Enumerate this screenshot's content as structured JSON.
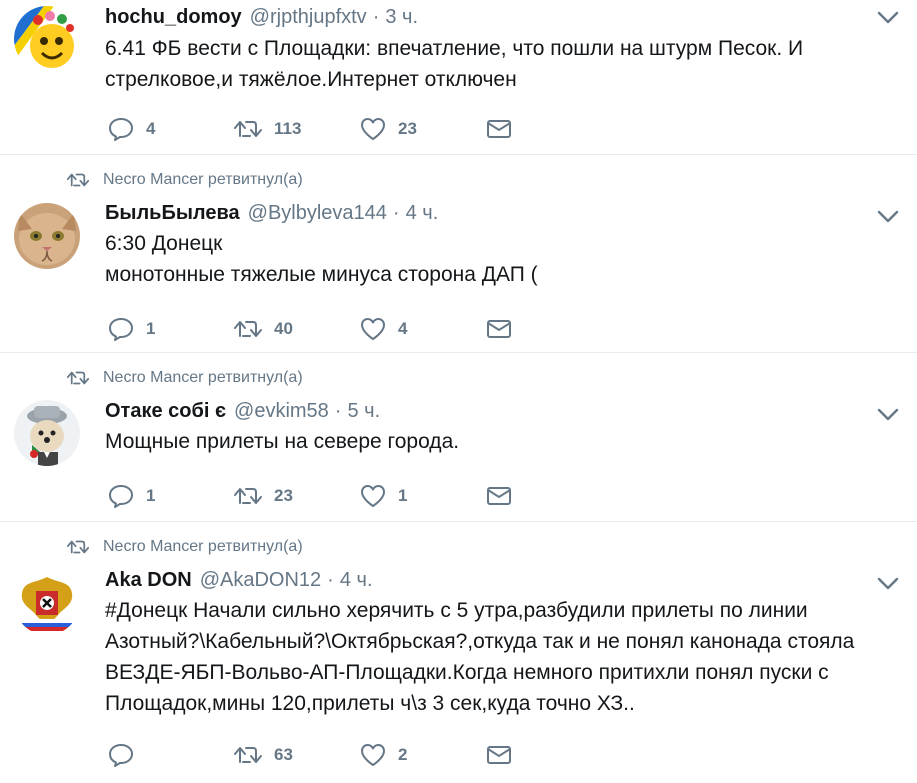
{
  "tweets": [
    {
      "retweeted_by": "",
      "fullname": "hochu_domoy",
      "username": "@rjpthjupfxtv",
      "dot": "·",
      "time": "3 ч.",
      "text": "6.41 ФБ вести с Площадки: впечатление, что пошли на штурм Песок. И\nстрелковое,и тяжёлое.Интернет отключен",
      "replies": "4",
      "retweets": "113",
      "likes": "23"
    },
    {
      "retweeted_by": "Necro Mancer ретвитнул(а)",
      "fullname": "БыльБылева",
      "username": "@Bylbyleva144",
      "dot": "·",
      "time": "4 ч.",
      "text": "6:30 Донецк\nмонотонные тяжелые минуса сторона ДАП (",
      "replies": "1",
      "retweets": "40",
      "likes": "4"
    },
    {
      "retweeted_by": "Necro Mancer ретвитнул(а)",
      "fullname": "Отаке собі є",
      "username": "@evkim58",
      "dot": "·",
      "time": "5 ч.",
      "text": "Мощные прилеты на севере города.",
      "replies": "1",
      "retweets": "23",
      "likes": "1"
    },
    {
      "retweeted_by": "Necro Mancer ретвитнул(а)",
      "fullname": "Aka DON",
      "username": "@AkaDON12",
      "dot": "·",
      "time": "4 ч.",
      "text": "#Донецк Начали сильно херячить с 5 утра,разбудили прилеты по линии\nАзотный?\\Кабельный?\\Октябрьская?,откуда так и не понял канонада стояла\nВЕЗДЕ-ЯБП-Вольво-АП-Площадки.Когда немного притихли понял пуски с\nПлощадок,мины 120,прилеты ч\\з 3 сек,куда точно ХЗ..",
      "replies": "",
      "retweets": "63",
      "likes": "2"
    }
  ],
  "icons": {
    "reply": "reply-icon",
    "retweet": "retweet-icon",
    "like": "like-icon",
    "dm": "direct-message-icon",
    "more": "chevron-down-icon"
  },
  "colors": {
    "text": "#14171a",
    "muted": "#657786",
    "border": "#e6ecf0"
  }
}
